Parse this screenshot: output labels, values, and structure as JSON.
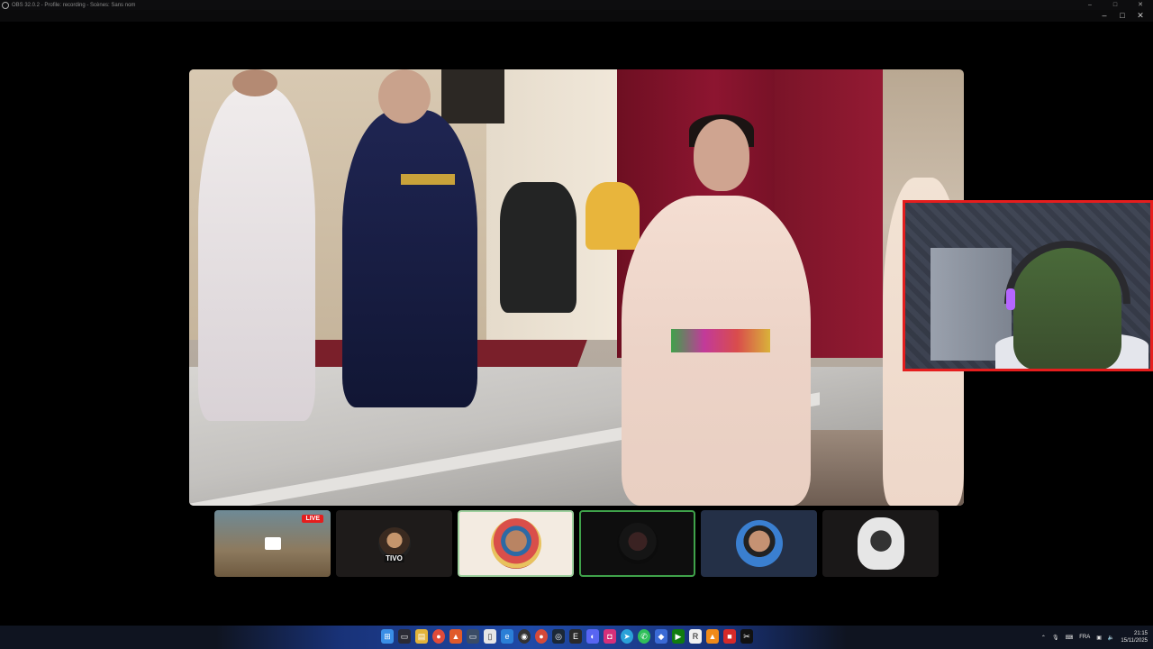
{
  "window": {
    "title": "OBS 32.0.2 - Profile: recording - Scènes: Sans nom",
    "minimize": "–",
    "maximize": "□",
    "close": "✕"
  },
  "preview": {
    "main_video": "video-feed",
    "webcam": "webcam-overlay"
  },
  "participants": {
    "tiles": [
      {
        "name": "screen-share",
        "badge": "LIVE"
      },
      {
        "name": "tivo",
        "label": "TIVO"
      },
      {
        "name": "avatar-3"
      },
      {
        "name": "avatar-4"
      },
      {
        "name": "avatar-5"
      },
      {
        "name": "avatar-6"
      }
    ]
  },
  "taskbar": {
    "icons": [
      "windows-start-icon",
      "task-view-icon",
      "file-explorer-icon",
      "chrome-icon",
      "brave-icon",
      "desktop-icon",
      "files-icon",
      "edge-icon",
      "obs-icon",
      "chrome-alt-icon",
      "steam-icon",
      "epic-icon",
      "discord-icon",
      "instagram-icon",
      "telegram-icon",
      "whatsapp-icon",
      "vpn-icon",
      "gamepass-icon",
      "rockstar-icon",
      "vlc-icon",
      "red-app-icon",
      "capcut-icon"
    ],
    "language": "FRA",
    "time": "21:15",
    "date": "15/11/2025"
  },
  "colors": {
    "webcam_border": "#e51d1d",
    "live_badge": "#e51d1d",
    "active_tile_border": "#3fa24a"
  }
}
